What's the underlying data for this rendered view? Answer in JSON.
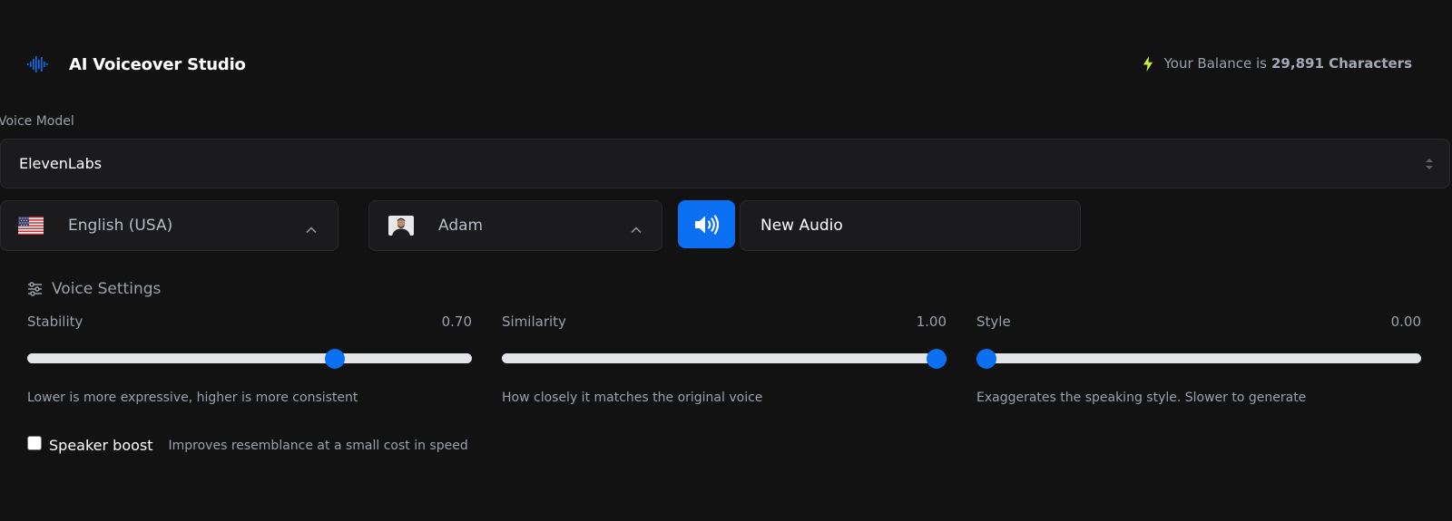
{
  "header": {
    "app_title": "AI Voiceover Studio",
    "logo_icon": "waveform-icon",
    "balance": {
      "icon": "bolt-icon",
      "prefix": "Your Balance is",
      "value": "29,891 Characters",
      "icon_color": "#c6f432"
    }
  },
  "voice_model": {
    "label": "Voice Model",
    "selected": "ElevenLabs"
  },
  "language": {
    "icon": "us-flag-icon",
    "selected": "English (USA)"
  },
  "voice": {
    "icon": "avatar",
    "selected": "Adam"
  },
  "play_button": {
    "icon": "speaker-icon",
    "color": "#0a6ff0"
  },
  "title_input": {
    "value": "New Audio"
  },
  "voice_settings": {
    "title": "Voice Settings",
    "icon": "sliders-icon",
    "sliders": [
      {
        "label": "Stability",
        "value_text": "0.70",
        "value": 0.7,
        "min": 0,
        "max": 1,
        "hint": "Lower is more expressive, higher is more consistent"
      },
      {
        "label": "Similarity",
        "value_text": "1.00",
        "value": 1.0,
        "min": 0,
        "max": 1,
        "hint": "How closely it matches the original voice"
      },
      {
        "label": "Style",
        "value_text": "0.00",
        "value": 0.0,
        "min": 0,
        "max": 1,
        "hint": "Exaggerates the speaking style. Slower to generate"
      }
    ],
    "speaker_boost": {
      "label": "Speaker boost",
      "hint": "Improves resemblance at a small cost in speed",
      "checked": false
    }
  },
  "colors": {
    "background": "#121213",
    "accent": "#0a6ff0",
    "muted_text": "#9aa0ab"
  }
}
